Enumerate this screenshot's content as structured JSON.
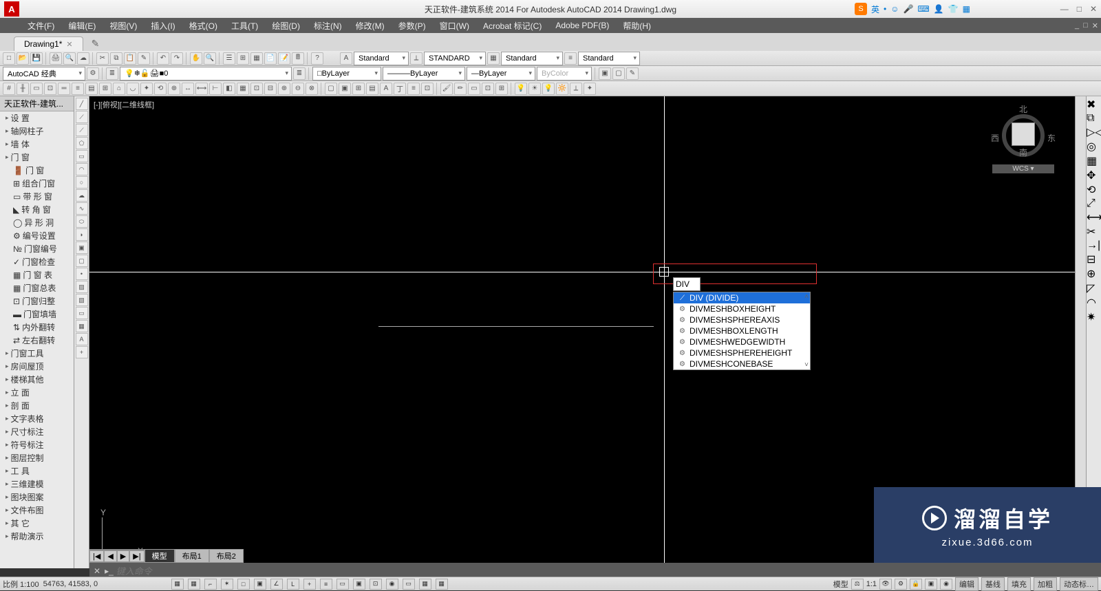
{
  "title": "天正软件-建筑系统 2014  For Autodesk AutoCAD 2014   Drawing1.dwg",
  "ime": {
    "lang": "英"
  },
  "window_controls": {
    "min": "—",
    "max": "□",
    "close": "✕"
  },
  "menus": [
    "文件(F)",
    "编辑(E)",
    "视图(V)",
    "插入(I)",
    "格式(O)",
    "工具(T)",
    "绘图(D)",
    "标注(N)",
    "修改(M)",
    "参数(P)",
    "窗口(W)",
    "Acrobat 标记(C)",
    "Adobe PDF(B)",
    "帮助(H)"
  ],
  "tabs": [
    {
      "label": "Drawing1*",
      "closable": true
    }
  ],
  "toolbar1": {
    "workspace": "AutoCAD 经典",
    "layer": "0",
    "textstyle": "Standard",
    "dimstyle": "STANDARD",
    "tablestyle": "Standard",
    "mlstyle": "Standard",
    "linetype_layer": "ByLayer",
    "linetype": "ByLayer",
    "lineweight": "ByLayer",
    "color": "ByColor"
  },
  "side_panel": {
    "title": "天正软件-建筑...",
    "groups": [
      [
        "设    置",
        "轴网柱子",
        "墙    体",
        "门    窗"
      ],
      [
        "门    窗",
        "组合门窗",
        "带 形 窗",
        "转 角 窗",
        "异 形 洞"
      ],
      [
        "编号设置",
        "门窗编号",
        "门窗检查",
        "门 窗 表",
        "门窗总表"
      ],
      [
        "门窗归整",
        "门窗填墙",
        "内外翻转",
        "左右翻转",
        "门窗工具"
      ],
      [
        "房间屋顶",
        "楼梯其他",
        "立    面",
        "剖    面",
        "文字表格",
        "尺寸标注",
        "符号标注",
        "图层控制",
        "工    具",
        "三维建模",
        "图块图案",
        "文件布图",
        "其    它",
        "帮助演示"
      ]
    ]
  },
  "canvas": {
    "viewlabel": "[-][俯视][二维线框]",
    "compass": {
      "n": "北",
      "s": "南",
      "e": "东",
      "w": "西",
      "wcs": "WCS ▾"
    }
  },
  "command_popup": {
    "input": "DIV",
    "items": [
      {
        "label": "DIV (DIVIDE)",
        "selected": true,
        "sys": false
      },
      {
        "label": "DIVMESHBOXHEIGHT",
        "selected": false,
        "sys": true
      },
      {
        "label": "DIVMESHSPHEREAXIS",
        "selected": false,
        "sys": true
      },
      {
        "label": "DIVMESHBOXLENGTH",
        "selected": false,
        "sys": true
      },
      {
        "label": "DIVMESHWEDGEWIDTH",
        "selected": false,
        "sys": true
      },
      {
        "label": "DIVMESHSPHEREHEIGHT",
        "selected": false,
        "sys": true
      },
      {
        "label": "DIVMESHCONEBASE",
        "selected": false,
        "sys": true
      }
    ]
  },
  "layout_tabs": {
    "nav": [
      "|◀",
      "◀",
      "▶",
      "▶|"
    ],
    "tabs": [
      "模型",
      "布局1",
      "布局2"
    ]
  },
  "command_bar": {
    "placeholder": "键入命令",
    "prompt": "▸_"
  },
  "status": {
    "scale": "比例 1:100",
    "coords": "54763,   41583, 0",
    "right_scale": "1:1",
    "ann_scale": "▲",
    "toggles": [
      "编辑",
      "基线",
      "填充",
      "加粗",
      "动态标…"
    ]
  },
  "watermark": {
    "text": "溜溜自学",
    "url": "zixue.3d66.com"
  }
}
